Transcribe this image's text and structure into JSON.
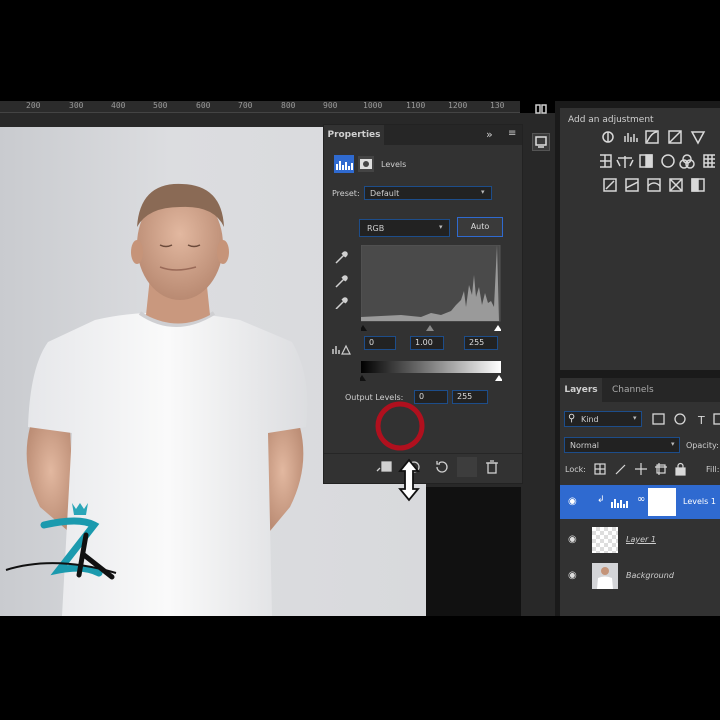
{
  "ruler": {
    "ticks": [
      "200",
      "300",
      "400",
      "500",
      "600",
      "700",
      "800",
      "900",
      "1000",
      "1100",
      "1200",
      "130"
    ]
  },
  "properties": {
    "title": "Properties",
    "collapse_icon": "double-chevron-right-icon",
    "section": "Levels",
    "preset_label": "Preset:",
    "preset_value": "Default",
    "channel_value": "RGB",
    "auto_label": "Auto",
    "input_black": "0",
    "input_gamma": "1.00",
    "input_white": "255",
    "output_label": "Output Levels:",
    "output_black": "0",
    "output_white": "255"
  },
  "adjustments": {
    "title": "Add an adjustment"
  },
  "layers": {
    "tabs": [
      "Layers",
      "Channels"
    ],
    "filter_kind": "Kind",
    "blend_mode": "Normal",
    "opacity_label": "Opacity:",
    "lock_label": "Lock:",
    "fill_label": "Fill:",
    "items": [
      {
        "name": "Levels 1",
        "selected": true
      },
      {
        "name": "Layer 1",
        "selected": false
      },
      {
        "name": "Background",
        "selected": false
      }
    ]
  },
  "colors": {
    "accent": "#2f6ad0",
    "panel": "#323232",
    "annotation_circle": "#b0101e"
  }
}
